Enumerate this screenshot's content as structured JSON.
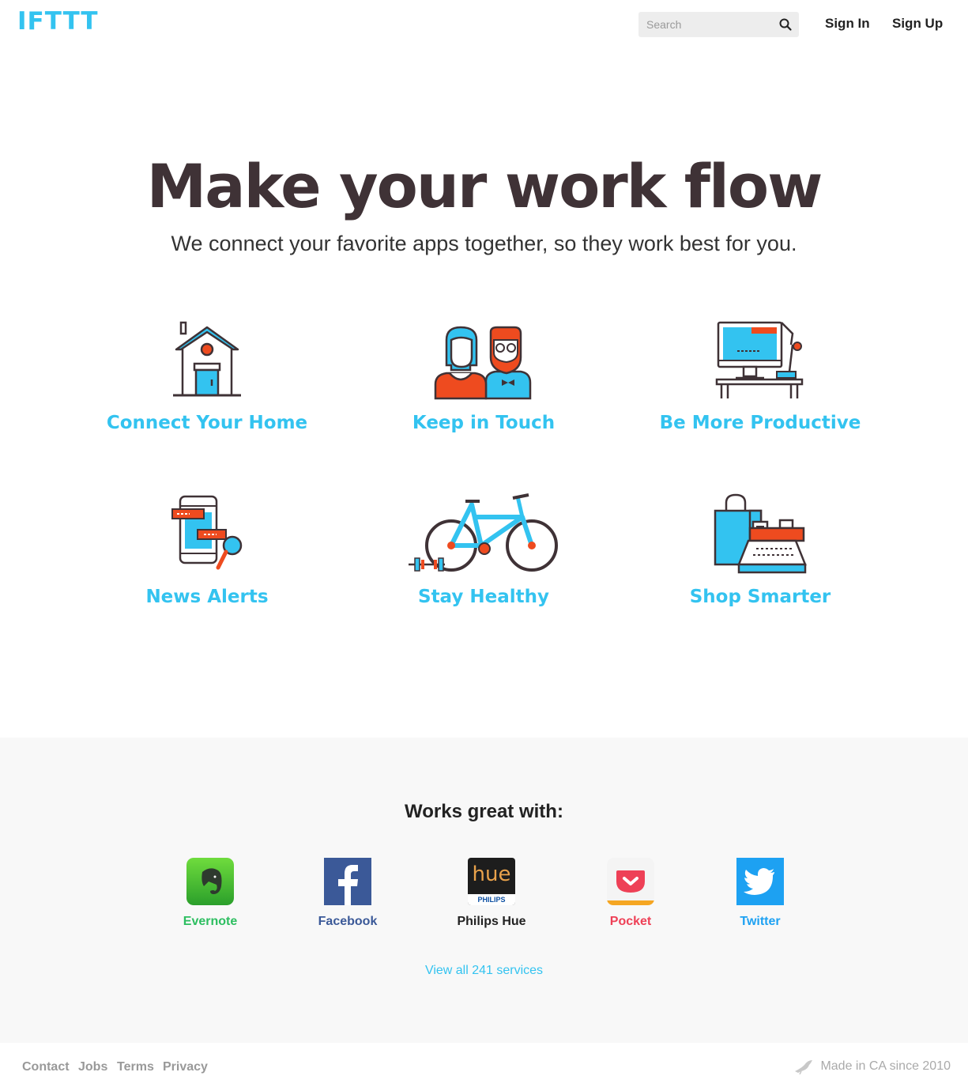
{
  "header": {
    "logo": "IFTTT",
    "search_placeholder": "Search",
    "sign_in": "Sign In",
    "sign_up": "Sign Up"
  },
  "hero": {
    "title": "Make your work flow",
    "subtitle": "We connect your favorite apps together, so they work best for you."
  },
  "categories": [
    {
      "label": "Connect Your Home",
      "icon": "house-icon"
    },
    {
      "label": "Keep in Touch",
      "icon": "people-icon"
    },
    {
      "label": "Be More Productive",
      "icon": "computer-desk-icon"
    },
    {
      "label": "News Alerts",
      "icon": "phone-news-icon"
    },
    {
      "label": "Stay Healthy",
      "icon": "bicycle-icon"
    },
    {
      "label": "Shop Smarter",
      "icon": "shopping-register-icon"
    }
  ],
  "works_with": {
    "title": "Works great with:",
    "services": [
      {
        "name": "Evernote",
        "color": "#2dbe60"
      },
      {
        "name": "Facebook",
        "color": "#3b5998"
      },
      {
        "name": "Philips Hue",
        "color": "#222222",
        "icon_text": "hue",
        "icon_sub": "PHILIPS"
      },
      {
        "name": "Pocket",
        "color": "#ee4056"
      },
      {
        "name": "Twitter",
        "color": "#1da1f2"
      }
    ],
    "view_all": "View all 241 services"
  },
  "footer": {
    "links": [
      "Contact",
      "Jobs",
      "Terms",
      "Privacy"
    ],
    "made_in": "Made in CA since 2010"
  },
  "colors": {
    "accent": "#33c3f0",
    "orange": "#ee4b1f",
    "dark": "#3f3236"
  }
}
